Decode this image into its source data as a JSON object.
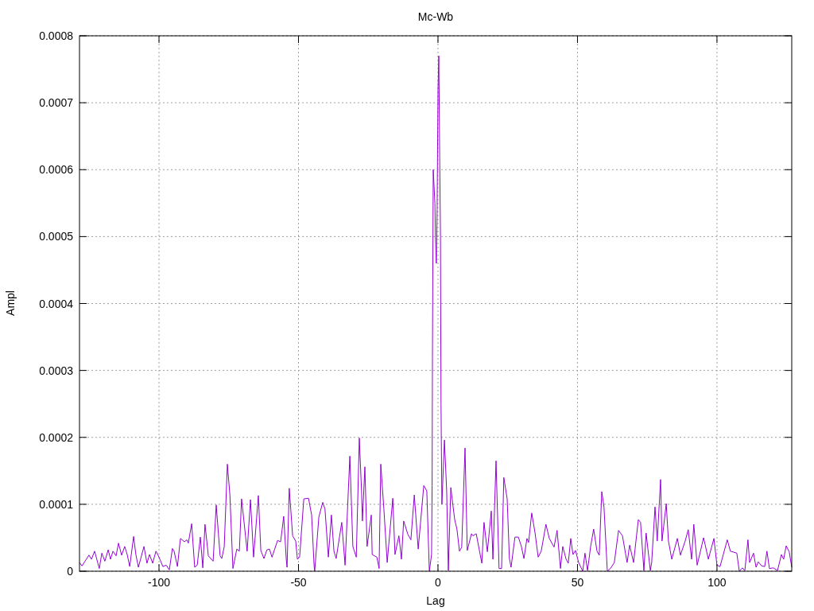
{
  "chart_data": {
    "type": "line",
    "grid": true,
    "title": "Mc-Wb",
    "xlabel": "Lag",
    "ylabel": "Ampl",
    "xlim": [
      -128.5,
      126.8
    ],
    "ylim": [
      0,
      0.0008
    ],
    "xticks": [
      -100,
      -50,
      0,
      50,
      100
    ],
    "yticks": [
      {
        "value": 0,
        "label": "0"
      },
      {
        "value": 0.0001,
        "label": "0.0001"
      },
      {
        "value": 0.0002,
        "label": "0.0002"
      },
      {
        "value": 0.0003,
        "label": "0.0003"
      },
      {
        "value": 0.0004,
        "label": "0.0004"
      },
      {
        "value": 0.0005,
        "label": "0.0005"
      },
      {
        "value": 0.0006,
        "label": "0.0006"
      },
      {
        "value": 0.0007,
        "label": "0.0007"
      },
      {
        "value": 0.0008,
        "label": "0.0008"
      }
    ],
    "x": [
      -128.5,
      -127.6,
      -125.1,
      -124.2,
      -123.1,
      -121.4,
      -120.5,
      -119.4,
      -118.2,
      -117.4,
      -116.5,
      -115.4,
      -114.5,
      -113.4,
      -112.3,
      -111.4,
      -110.5,
      -109.1,
      -108.3,
      -107.4,
      -105.4,
      -104.3,
      -103.4,
      -102.3,
      -101.1,
      -100,
      -98.6,
      -97.4,
      -96.3,
      -95.2,
      -94.6,
      -93.4,
      -92.3,
      -90.9,
      -90,
      -89.5,
      -88.3,
      -87.2,
      -86.3,
      -85.2,
      -84.3,
      -83.5,
      -82.3,
      -80.6,
      -79.5,
      -78.1,
      -77.5,
      -76.6,
      -75.5,
      -74.6,
      -73.5,
      -72.1,
      -71.2,
      -70.4,
      -68.4,
      -67.2,
      -66.1,
      -64.4,
      -63.5,
      -62.4,
      -61.3,
      -60.4,
      -59.5,
      -57.5,
      -56.4,
      -55.3,
      -54.4,
      -54.1,
      -53.3,
      -52.1,
      -51,
      -50.4,
      -49.6,
      -48.1,
      -46.4,
      -45.3,
      -44.4,
      -44.2,
      -42.7,
      -41.3,
      -40.5,
      -39.3,
      -38.2,
      -37.3,
      -36.5,
      -34.5,
      -33.3,
      -31.6,
      -30.5,
      -29.3,
      -28.2,
      -27.4,
      -27.1,
      -26.2,
      -25.4,
      -23.9,
      -23.6,
      -21.9,
      -21.1,
      -20.5,
      -19.4,
      -18.2,
      -16.2,
      -15.4,
      -14,
      -13.1,
      -12.3,
      -10.8,
      -9.7,
      -8.5,
      -7.1,
      -5.1,
      -4,
      -3.1,
      -2.3,
      -2.1,
      -2,
      -1.7,
      -1.1,
      -0.9,
      -0.6,
      -0.3,
      0,
      0.3,
      0.6,
      0.9,
      1.1,
      1.4,
      1.7,
      2.3,
      3.1,
      3.7,
      4.6,
      5.1,
      6,
      6.8,
      7.7,
      8.5,
      9.7,
      10.5,
      12,
      12.5,
      13.7,
      15.7,
      16.5,
      17.7,
      19.1,
      19.7,
      20.8,
      21.9,
      22.8,
      23.6,
      24.8,
      25.6,
      26.2,
      27.6,
      28.8,
      29.9,
      30.8,
      31.9,
      32.5,
      33.6,
      34.8,
      35.9,
      37,
      38.7,
      39.9,
      41.6,
      42.7,
      43.9,
      44.7,
      45.9,
      46.7,
      47.6,
      48.4,
      49.3,
      50.4,
      51.9,
      52.7,
      53.6,
      54.7,
      55.8,
      57,
      57.8,
      58.7,
      59.5,
      60.7,
      61.8,
      63.2,
      64.7,
      66.1,
      67.8,
      68.7,
      70.1,
      71.8,
      72.6,
      73.8,
      74.6,
      76.1,
      76.6,
      77.8,
      78.6,
      79.8,
      80.3,
      81.8,
      82.6,
      83.8,
      85.8,
      86.9,
      88.6,
      89.7,
      90.9,
      91.7,
      92.9,
      95.2,
      96.9,
      98.9,
      100,
      101.1,
      103.7,
      104.8,
      107.1,
      108,
      109.1,
      110,
      111.1,
      111.7,
      113.1,
      114,
      114.8,
      116,
      117.1,
      117.9,
      118.8,
      120.2,
      121.7,
      123.1,
      123.9,
      124.8,
      125.9,
      126.8
    ],
    "series": [
      {
        "color": "#9400d3",
        "values": [
          1.3e-05,
          8e-06,
          2.4e-05,
          1.8e-05,
          3e-05,
          4e-06,
          2.7e-05,
          1.5e-05,
          3.2e-05,
          1.8e-05,
          3e-05,
          2.3e-05,
          4.2e-05,
          2.4e-05,
          3.7e-05,
          2.5e-05,
          7e-06,
          5.2e-05,
          2.5e-05,
          6e-06,
          3.7e-05,
          1.2e-05,
          2.5e-05,
          1.2e-05,
          3e-05,
          2.1e-05,
          7e-06,
          9e-06,
          2e-06,
          3.4e-05,
          3e-05,
          7e-06,
          4.9e-05,
          4.4e-05,
          4.7e-05,
          4.2e-05,
          7.1e-05,
          6e-06,
          9e-06,
          5.1e-05,
          5e-06,
          7e-05,
          2.3e-05,
          1.5e-05,
          9.9e-05,
          2.3e-05,
          1.9e-05,
          3.7e-05,
          0.00016,
          0.000114,
          4e-06,
          3.3e-05,
          3e-05,
          0.000108,
          3e-05,
          0.000107,
          2.1e-05,
          0.000113,
          3.1e-05,
          1.9e-05,
          3.2e-05,
          3.3e-05,
          2.1e-05,
          4.6e-05,
          4.4e-05,
          8.2e-05,
          1.8e-05,
          6e-06,
          0.000124,
          5.3e-05,
          4.5e-05,
          1.8e-05,
          2.1e-05,
          0.000108,
          0.000109,
          8.4e-05,
          7e-06,
          0,
          8.1e-05,
          0.000103,
          9.3e-05,
          2.1e-05,
          8.4e-05,
          3e-05,
          1.9e-05,
          7.3e-05,
          9e-06,
          0.000172,
          3.7e-05,
          2.1e-05,
          0.000199,
          0.00012,
          7.5e-05,
          0.000156,
          3.7e-05,
          8.4e-05,
          2.5e-05,
          2.1e-05,
          4e-06,
          0.00016,
          9.3e-05,
          1.3e-05,
          0.000109,
          2.5e-05,
          5.3e-05,
          1.8e-05,
          7.5e-05,
          5.5e-05,
          4.7e-05,
          0.000114,
          3.3e-05,
          0.000128,
          0.00012,
          0,
          2.5e-05,
          0.000128,
          0.00032,
          0.0006,
          0.00055,
          0.0005,
          0.00046,
          0.00054,
          0.00072,
          0.00077,
          0.00062,
          0.0005,
          0.00025,
          0.0001,
          0.00013,
          0.000196,
          0.00012,
          1e-06,
          0.000125,
          0.000107,
          7.7e-05,
          6.3e-05,
          3e-05,
          3.6e-05,
          0.000184,
          3.1e-05,
          5.6e-05,
          5.3e-05,
          5.6e-05,
          1.2e-05,
          7.3e-05,
          2.9e-05,
          9e-05,
          1.8e-05,
          0.000165,
          4e-06,
          4e-06,
          0.00014,
          0.000108,
          1.9e-05,
          6e-06,
          5.1e-05,
          5.1e-05,
          3.7e-05,
          1.9e-05,
          4.9e-05,
          4.3e-05,
          8.7e-05,
          5.7e-05,
          2.1e-05,
          3e-05,
          7e-05,
          4.9e-05,
          3.6e-05,
          6.1e-05,
          4e-06,
          3.7e-05,
          1.8e-05,
          1.2e-05,
          4.9e-05,
          2.5e-05,
          3.1e-05,
          1.3e-05,
          0,
          2.7e-05,
          1e-06,
          3.7e-05,
          6.3e-05,
          3e-05,
          2.4e-05,
          0.000119,
          9.6e-05,
          0,
          4e-06,
          1.3e-05,
          6.1e-05,
          5.3e-05,
          1.3e-05,
          3.9e-05,
          1.3e-05,
          7.7e-05,
          7.3e-05,
          1e-06,
          5.7e-05,
          1e-06,
          1.3e-05,
          9.6e-05,
          4.5e-05,
          0.000137,
          4.5e-05,
          0.000101,
          4.5e-05,
          1.8e-05,
          4.9e-05,
          2.4e-05,
          4.5e-05,
          6.2e-05,
          1.8e-05,
          7e-05,
          9e-06,
          5e-05,
          1.8e-05,
          4.9e-05,
          9e-06,
          7e-06,
          4.7e-05,
          3e-05,
          2.7e-05,
          0,
          5e-06,
          1e-06,
          4.7e-05,
          1.3e-05,
          2.7e-05,
          6e-06,
          1.4e-05,
          8e-06,
          7e-06,
          3e-05,
          4e-06,
          5e-06,
          1e-06,
          2.5e-05,
          1.8e-05,
          3.8e-05,
          2.9e-05,
          6e-06
        ]
      }
    ]
  }
}
